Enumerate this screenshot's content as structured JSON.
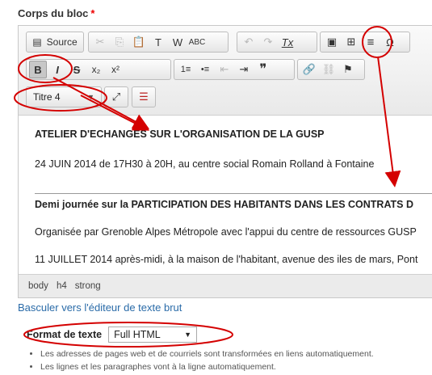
{
  "field_label": "Corps du bloc",
  "required_marker": "*",
  "toolbar": {
    "source_label": "Source",
    "heading_select_value": "Titre 4",
    "icons_row1": {
      "cut": "✂",
      "copy": "⎘",
      "paste": "📋",
      "paste_text": "T",
      "paste_word": "W",
      "spellcheck": "ABC",
      "undo": "↶",
      "redo": "↷",
      "remove_format": "Tx",
      "image": "▣",
      "table": "⊞",
      "horizontal_rule": "≡",
      "special_char": "Ω"
    },
    "icons_row2": {
      "bold": "B",
      "italic": "I",
      "strike": "S",
      "subscript": "x₂",
      "superscript": "x²",
      "numbered_list": "1≡",
      "bulleted_list": "•≡",
      "outdent": "⇤",
      "indent": "⇥",
      "blockquote": "❞",
      "link": "🔗",
      "unlink": "⛓",
      "anchor": "⚑"
    },
    "maximize": "⤢",
    "show_blocks": "☰"
  },
  "content": {
    "heading1": "ATELIER D'ECHANGES SUR L'ORGANISATION DE LA GUSP",
    "para1": "24 JUIN 2014 de 17H30 à 20H, au centre social Romain Rolland à Fontaine",
    "heading2": "Demi journée sur la PARTICIPATION DES HABITANTS DANS LES CONTRATS D",
    "para2": "Organisée par Grenoble Alpes Métropole avec l'appui du centre de ressources GUSP",
    "para3": "11 JUILLET 2014 après-midi, à la maison de l'habitant, avenue des iles de mars, Pont"
  },
  "path": [
    "body",
    "h4",
    "strong"
  ],
  "toggle_link": "Basculer vers l'éditeur de texte brut",
  "format": {
    "label": "Format de texte",
    "value": "Full HTML"
  },
  "tips": [
    "Les adresses de pages web et de courriels sont transformées en liens automatiquement.",
    "Les lignes et les paragraphes vont à la ligne automatiquement."
  ],
  "colors": {
    "annotation": "#d40000",
    "link": "#2a6ba8",
    "required": "#ee0000"
  }
}
